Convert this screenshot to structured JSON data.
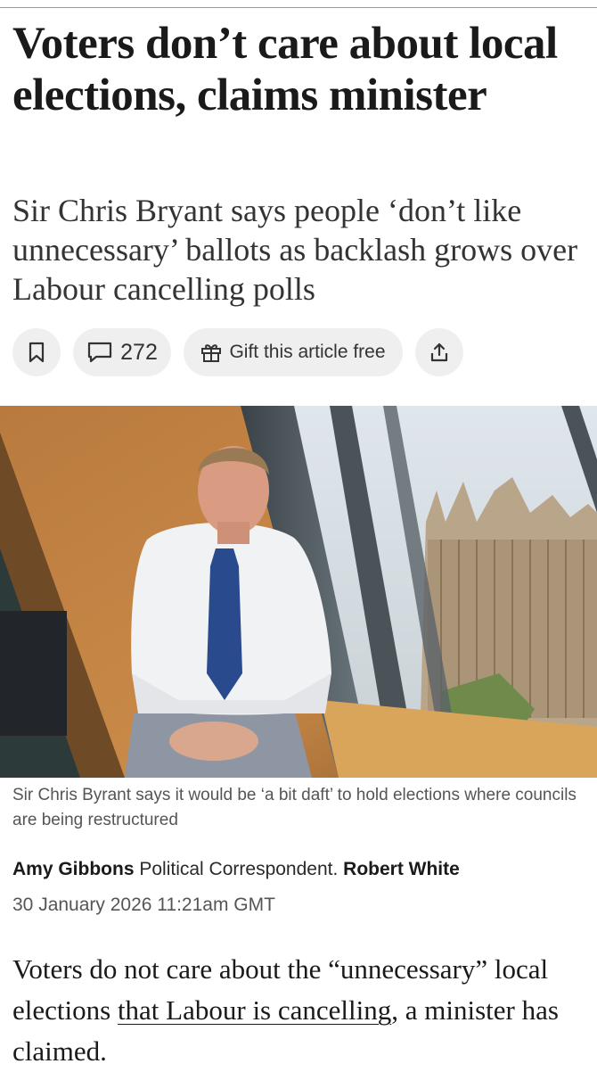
{
  "article": {
    "headline": "Voters don’t care about local elections, claims minister",
    "standfirst": "Sir Chris Bryant says people ‘don’t like unnecessary’ ballots as backlash grows over Labour cancelling polls",
    "actions": {
      "save_icon": "bookmark-icon",
      "comment_icon": "comment-icon",
      "comment_count": "272",
      "gift_icon": "gift-icon",
      "gift_label": "Gift this article free",
      "share_icon": "share-icon"
    },
    "image": {
      "caption": "Sir Chris Byrant says it would be ‘a bit daft’ to hold elections where councils are being restructured"
    },
    "byline": {
      "author1": "Amy Gibbons",
      "author1_role": "Political Correspondent.",
      "author2": "Robert White",
      "date": "30 January 2026 11:21am GMT"
    },
    "body": {
      "before_link": "Voters do not care about the “unnecessary” local elections ",
      "link_text": "that Labour is cancelling",
      "after_link": ", a minister has claimed."
    }
  },
  "colors": {
    "action_bg": "#efefef",
    "text": "#1a1a1a",
    "caption": "#555555"
  }
}
